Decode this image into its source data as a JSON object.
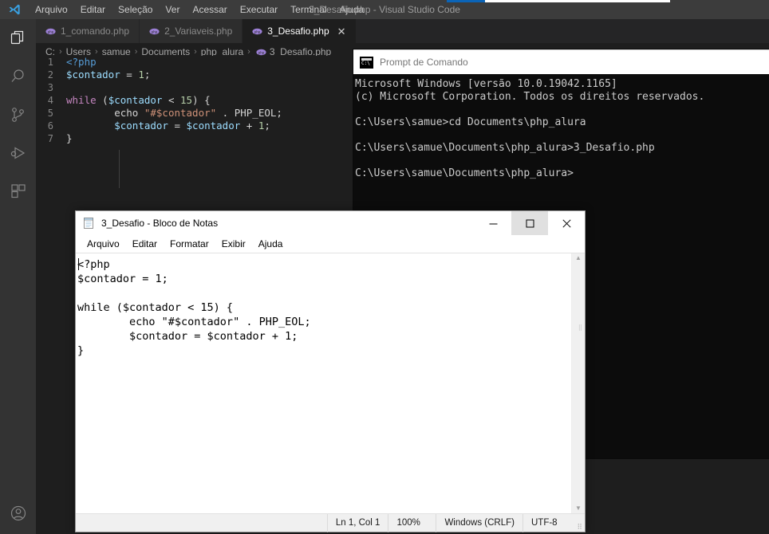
{
  "vscode": {
    "window_title": "3_Desafio.php - Visual Studio Code",
    "menu": [
      "Arquivo",
      "Editar",
      "Seleção",
      "Ver",
      "Acessar",
      "Executar",
      "Terminal",
      "Ajuda"
    ],
    "activity_icons": [
      "explorer-icon",
      "search-icon",
      "source-control-icon",
      "run-debug-icon",
      "extensions-icon",
      "account-icon"
    ],
    "tabs": [
      {
        "label": "1_comando.php",
        "active": false,
        "closable": false
      },
      {
        "label": "2_Variaveis.php",
        "active": false,
        "closable": false
      },
      {
        "label": "3_Desafio.php",
        "active": true,
        "closable": true,
        "close_label": "✕"
      }
    ],
    "breadcrumb": [
      "C:",
      "Users",
      "samue",
      "Documents",
      "php_alura",
      "3_Desafio.php"
    ],
    "breadcrumb_separator": "›",
    "code_lines": [
      {
        "no": "1",
        "tokens": [
          {
            "t": "<?php",
            "c": "tk-tag"
          }
        ]
      },
      {
        "no": "2",
        "tokens": [
          {
            "t": "$contador",
            "c": "tk-var"
          },
          {
            "t": " = ",
            "c": "tk-op"
          },
          {
            "t": "1",
            "c": "tk-num"
          },
          {
            "t": ";",
            "c": "tk-op"
          }
        ]
      },
      {
        "no": "3",
        "tokens": []
      },
      {
        "no": "4",
        "tokens": [
          {
            "t": "while",
            "c": "tk-kw"
          },
          {
            "t": " (",
            "c": "tk-op"
          },
          {
            "t": "$contador",
            "c": "tk-var"
          },
          {
            "t": " < ",
            "c": "tk-op"
          },
          {
            "t": "15",
            "c": "tk-num"
          },
          {
            "t": ") {",
            "c": "tk-op"
          }
        ]
      },
      {
        "no": "5",
        "tokens": [
          {
            "t": "        echo ",
            "c": "tk-const"
          },
          {
            "t": "\"#$contador\"",
            "c": "tk-str"
          },
          {
            "t": " . ",
            "c": "tk-op"
          },
          {
            "t": "PHP_EOL",
            "c": "tk-const"
          },
          {
            "t": ";",
            "c": "tk-op"
          }
        ]
      },
      {
        "no": "6",
        "tokens": [
          {
            "t": "        ",
            "c": "tk-op"
          },
          {
            "t": "$contador",
            "c": "tk-var"
          },
          {
            "t": " = ",
            "c": "tk-op"
          },
          {
            "t": "$contador",
            "c": "tk-var"
          },
          {
            "t": " + ",
            "c": "tk-op"
          },
          {
            "t": "1",
            "c": "tk-num"
          },
          {
            "t": ";",
            "c": "tk-op"
          }
        ]
      },
      {
        "no": "7",
        "tokens": [
          {
            "t": "}",
            "c": "tk-op"
          }
        ]
      }
    ]
  },
  "cmd": {
    "title": "Prompt de Comando",
    "icon_text": "C:\\",
    "minimize_label": "–",
    "output": "Microsoft Windows [versão 10.0.19042.1165]\n(c) Microsoft Corporation. Todos os direitos reservados.\n\nC:\\Users\\samue>cd Documents\\php_alura\n\nC:\\Users\\samue\\Documents\\php_alura>3_Desafio.php\n\nC:\\Users\\samue\\Documents\\php_alura>"
  },
  "notepad": {
    "title": "3_Desafio - Bloco de Notas",
    "menu": [
      "Arquivo",
      "Editar",
      "Formatar",
      "Exibir",
      "Ajuda"
    ],
    "buttons": {
      "minimize": "minimize-button",
      "maximize": "maximize-button",
      "close": "close-button"
    },
    "content": "<?php\n$contador = 1;\n\nwhile ($contador < 15) {\n        echo \"#$contador\" . PHP_EOL;\n        $contador = $contador + 1;\n}",
    "scrollbar": {
      "up_arrow": "▲",
      "down_arrow": "▼"
    },
    "status": {
      "position": "Ln 1, Col 1",
      "zoom": "100%",
      "line_endings": "Windows (CRLF)",
      "encoding": "UTF-8"
    }
  },
  "colors": {
    "vscode_bg": "#1e1e1e",
    "vscode_titlebar": "#3c3c3c",
    "vscode_activitybar": "#333333",
    "vscode_tabbar": "#252526",
    "cmd_bg": "#0c0c0c",
    "notepad_bg": "#ffffff",
    "accent_blue": "#0b64b7"
  }
}
